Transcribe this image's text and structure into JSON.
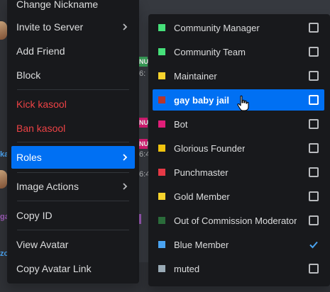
{
  "main_menu": {
    "items": [
      {
        "label": "Change Nickname"
      },
      {
        "label": "Invite to Server",
        "has_submenu": true
      },
      {
        "label": "Add Friend"
      },
      {
        "label": "Block"
      },
      {
        "label": "Kick kasool"
      },
      {
        "label": "Ban kasool"
      },
      {
        "label": "Roles",
        "has_submenu": true
      },
      {
        "label": "Image Actions",
        "has_submenu": true
      },
      {
        "label": "Copy ID"
      },
      {
        "label": "View Avatar"
      },
      {
        "label": "Copy Avatar Link"
      }
    ]
  },
  "roles_submenu": {
    "items": [
      {
        "label": "Community Manager",
        "color": "#46e07a",
        "checked": false
      },
      {
        "label": "Community Team",
        "color": "#46e07a",
        "checked": false
      },
      {
        "label": "Maintainer",
        "color": "#f6d32d",
        "checked": false
      },
      {
        "label": "gay baby jail",
        "color": "#b7362d",
        "checked": false,
        "active": true
      },
      {
        "label": "Bot",
        "color": "#e01e78",
        "checked": false
      },
      {
        "label": "Glorious Founder",
        "color": "#f1c40f",
        "checked": false
      },
      {
        "label": "Punchmaster",
        "color": "#e63946",
        "checked": false
      },
      {
        "label": "Gold Member",
        "color": "#f6d32d",
        "checked": false
      },
      {
        "label": "Out of Commission Moderator",
        "color": "#2a6b3a",
        "checked": false
      },
      {
        "label": "Blue Member",
        "color": "#4aa3f0",
        "checked": true
      },
      {
        "label": "muted",
        "color": "#99aab5",
        "checked": false
      }
    ]
  },
  "background": {
    "badge_1": "NU",
    "badge_2": "NU",
    "badge_3": "NU",
    "time_1": "6:",
    "time_2": "6:4",
    "time_3": "6:4",
    "frag_1": "ka",
    "frag_2": "ga",
    "frag_3": "zo"
  },
  "colors": {
    "menu_bg": "#18191c",
    "accent": "#0070f3",
    "danger": "#ed4245",
    "text": "#dcddde"
  },
  "icons": {
    "chevron": "chevron-right-icon",
    "check": "check-icon",
    "cursor": "hand-pointer-icon"
  }
}
